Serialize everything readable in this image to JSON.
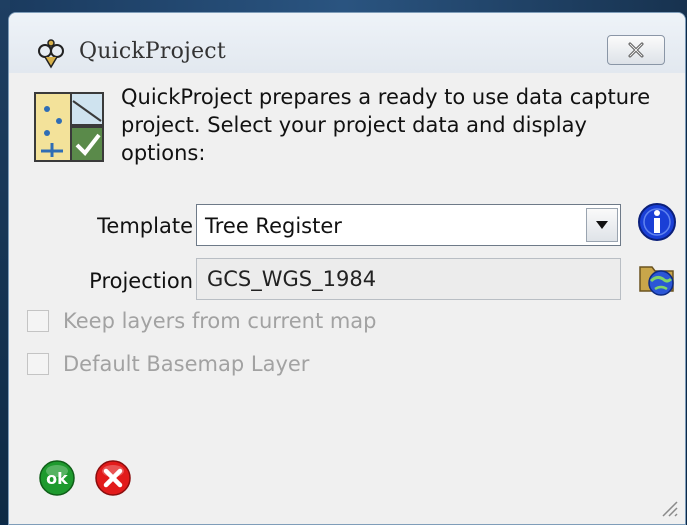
{
  "window": {
    "title": "QuickProject",
    "close_icon": "close-icon"
  },
  "description": "QuickProject prepares a ready to use data capture project. Select your project data and display options:",
  "template": {
    "label": "Template",
    "value": "Tree Register"
  },
  "projection": {
    "label": "Projection",
    "value": "GCS_WGS_1984"
  },
  "options": [
    {
      "label": "Keep layers from current map",
      "checked": false,
      "enabled": false
    },
    {
      "label": "Default Basemap Layer",
      "checked": false,
      "enabled": false
    }
  ],
  "buttons": {
    "ok_label": "ok"
  },
  "colors": {
    "ok_green": "#1e9a2e",
    "cancel_red": "#e21b1b",
    "info_blue": "#1a3fd6"
  }
}
